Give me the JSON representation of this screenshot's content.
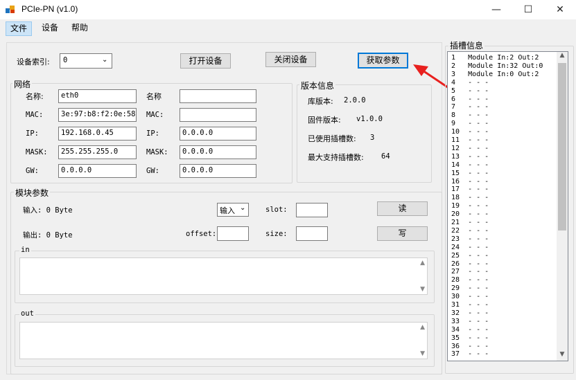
{
  "window": {
    "title": "PCIe-PN (v1.0)",
    "minimize_glyph": "—",
    "maximize_glyph": "☐",
    "close_glyph": "✕"
  },
  "menu": [
    "文件",
    "设备",
    "帮助"
  ],
  "device": {
    "index_label": "设备索引:",
    "index_value": "0",
    "open_button": "打开设备",
    "close_button": "关闭设备",
    "get_params_button": "获取参数"
  },
  "network": {
    "title": "网络",
    "left": {
      "name_label": "名称:",
      "name_value": "eth0",
      "mac_label": "MAC:",
      "mac_value": "3e:97:b8:f2:0e:58",
      "ip_label": "IP:",
      "ip_value": "192.168.0.45",
      "mask_label": "MASK:",
      "mask_value": "255.255.255.0",
      "gw_label": "GW:",
      "gw_value": "0.0.0.0"
    },
    "right": {
      "name_label": "名称",
      "name_value": "",
      "mac_label": "MAC:",
      "mac_value": "",
      "ip_label": "IP:",
      "ip_value": "0.0.0.0",
      "mask_label": "MASK:",
      "mask_value": "0.0.0.0",
      "gw_label": "GW:",
      "gw_value": "0.0.0.0"
    }
  },
  "version": {
    "title": "版本信息",
    "lib_label": "库版本:",
    "lib_value": "2.0.0",
    "fw_label": "固件版本:",
    "fw_value": "v1.0.0",
    "used_label": "已使用插槽数:",
    "used_value": "3",
    "max_label": "最大支持插槽数:",
    "max_value": "64"
  },
  "module": {
    "title": "模块参数",
    "input_label": "输入: 0 Byte",
    "output_label": "输出: 0 Byte",
    "direction_value": "输入",
    "slot_label": "slot:",
    "offset_label": "offset:",
    "size_label": "size:",
    "read_button": "读",
    "write_button": "写",
    "in_label": "in",
    "out_label": "out"
  },
  "slots": {
    "title": "插槽信息",
    "rows": [
      "1   Module In:2 Out:2",
      "2   Module In:32 Out:0",
      "3   Module In:0 Out:2",
      "4   - - -",
      "5   - - -",
      "6   - - -",
      "7   - - -",
      "8   - - -",
      "9   - - -",
      "10  - - -",
      "11  - - -",
      "12  - - -",
      "13  - - -",
      "14  - - -",
      "15  - - -",
      "16  - - -",
      "17  - - -",
      "18  - - -",
      "19  - - -",
      "20  - - -",
      "21  - - -",
      "22  - - -",
      "23  - - -",
      "24  - - -",
      "25  - - -",
      "26  - - -",
      "27  - - -",
      "28  - - -",
      "29  - - -",
      "30  - - -",
      "31  - - -",
      "32  - - -",
      "33  - - -",
      "34  - - -",
      "35  - - -",
      "36  - - -",
      "37  - - -"
    ]
  },
  "colors": {
    "accent": "#0078d7",
    "arrow": "#e8201e"
  }
}
